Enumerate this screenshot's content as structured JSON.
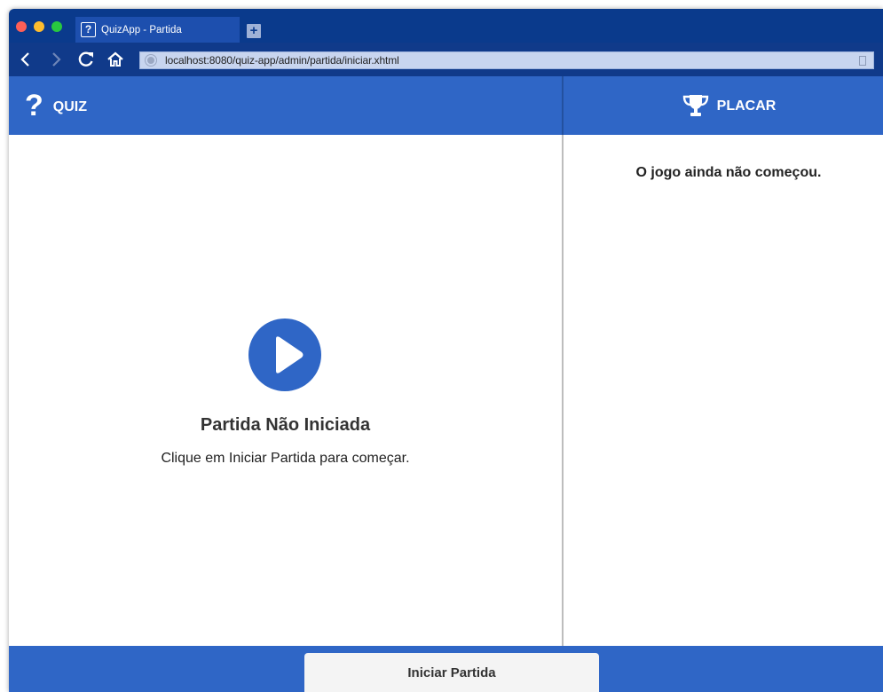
{
  "browser": {
    "tab_favicon": "?",
    "tab_title": "QuizApp - Partida",
    "new_tab_label": "+",
    "url": "localhost:8080/quiz-app/admin/partida/iniciar.xhtml",
    "nav": {
      "back_glyph": "‹",
      "forward_glyph": "›",
      "reload_glyph": "C"
    }
  },
  "header": {
    "quiz_icon": "?",
    "quiz_label": "QUIZ",
    "placar_label": "PLACAR"
  },
  "quiz": {
    "status_title": "Partida Não Iniciada",
    "status_subtitle": "Clique em Iniciar Partida para começar."
  },
  "placar": {
    "empty_message": "O jogo ainda não começou."
  },
  "footer": {
    "start_button_label": "Iniciar Partida"
  },
  "colors": {
    "primary": "#2f66c6",
    "tab_strip": "#0a3a8c",
    "toolbar": "#103a8a"
  }
}
